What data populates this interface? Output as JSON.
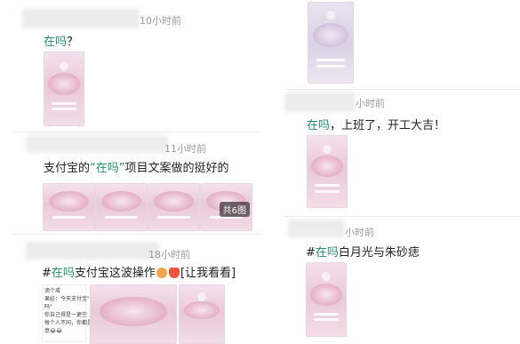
{
  "posts": [
    {
      "time": "10小时前",
      "text": "在吗？",
      "highlight": "在吗",
      "rest": "？"
    },
    {
      "time": "11小时前",
      "prefix": "支付宝的",
      "highlight": "“在吗”",
      "rest": "项目文案做的挺好的",
      "more_badge": "共6图"
    },
    {
      "time": "18小时前",
      "hash": "#",
      "highlight": "在吗",
      "rest_a": "支付宝这波操作",
      "rest_b": "[让我看看]",
      "chat_lines": [
        "滴个戒",
        "果娃：今天支付宝\"在",
        "吗\"",
        "你自己得是一更空",
        "每个人不同，你都是什么",
        "意😂😂"
      ]
    },
    {
      "time": "",
      "text": ""
    },
    {
      "time": "小时前",
      "highlight": "在吗",
      "rest": "，上班了，开工大吉！"
    },
    {
      "time": "小时前",
      "hash": "#",
      "highlight": "在吗",
      "rest": "白月光与朱砂痣"
    }
  ],
  "colors": {
    "highlight": "#1f8f6a",
    "thumb_pink": "#e9c9d8"
  }
}
